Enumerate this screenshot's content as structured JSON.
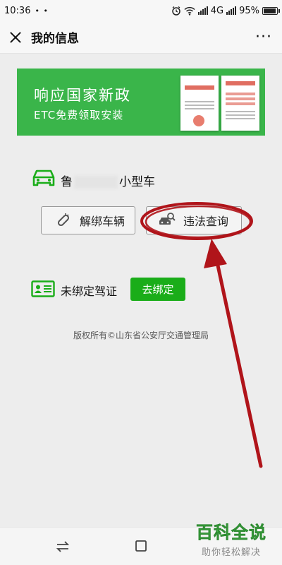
{
  "status_bar": {
    "time": "10:36",
    "dots": "• •",
    "network": "4G",
    "battery": "95%"
  },
  "header": {
    "title": "我的信息"
  },
  "banner": {
    "title": "响应国家新政",
    "subtitle": "ETC免费领取安装"
  },
  "vehicle": {
    "plate_prefix": "鲁",
    "plate_suffix": "小型车",
    "unbind_label": "解绑车辆",
    "query_label": "违法查询"
  },
  "license": {
    "label": "未绑定驾证",
    "bind_label": "去绑定"
  },
  "footer": {
    "copyright": "版权所有©山东省公安厅交通管理局"
  },
  "watermark": {
    "main": "百科全说",
    "sub": "助你轻松解决"
  },
  "colors": {
    "accent_green": "#1aad19",
    "banner_green": "#3ab54a",
    "annotation_red": "#b0141a"
  }
}
